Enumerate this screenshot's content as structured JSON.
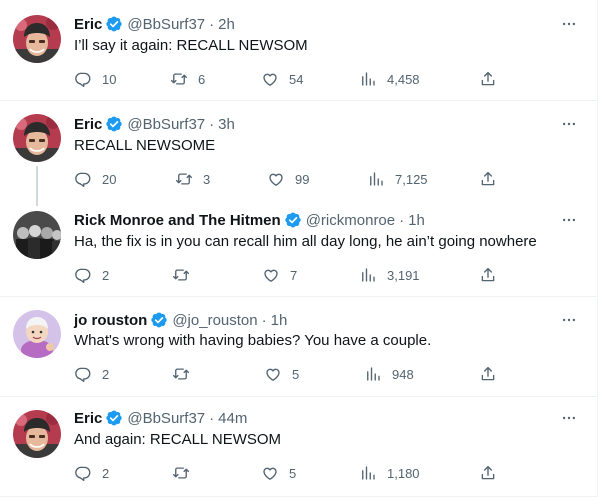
{
  "colors": {
    "verified": "#1d9bf0",
    "secondary_text": "#536471",
    "divider": "#eff3f4",
    "thread_line": "#cfd9de"
  },
  "icons": {
    "reply": "reply-icon",
    "retweet": "retweet-icon",
    "like": "heart-icon",
    "views": "views-icon",
    "share": "share-icon",
    "more": "more-icon",
    "verified": "verified-badge-icon"
  },
  "tweets": [
    {
      "name": "Eric",
      "handle": "@BbSurf37",
      "time": "2h",
      "text": "I’ll say it again: RECALL NEWSOM",
      "replies": "10",
      "retweets": "6",
      "likes": "54",
      "views": "4,458"
    },
    {
      "name": "Eric",
      "handle": "@BbSurf37",
      "time": "3h",
      "text": "RECALL NEWSOME",
      "replies": "20",
      "retweets": "3",
      "likes": "99",
      "views": "7,125"
    },
    {
      "name": "Rick Monroe and The Hitmen",
      "handle": "@rickmonroe",
      "time": "1h",
      "text": "Ha, the fix is in you can recall him all day long, he ain’t going nowhere",
      "replies": "2",
      "retweets": "",
      "likes": "7",
      "views": "3,191"
    },
    {
      "name": "jo rouston",
      "handle": "@jo_rouston",
      "time": "1h",
      "text": "What's wrong with having babies?  You have a couple.",
      "replies": "2",
      "retweets": "",
      "likes": "5",
      "views": "948"
    },
    {
      "name": "Eric",
      "handle": "@BbSurf37",
      "time": "44m",
      "text": "And again: RECALL NEWSOM",
      "replies": "2",
      "retweets": "",
      "likes": "5",
      "views": "1,180"
    }
  ]
}
